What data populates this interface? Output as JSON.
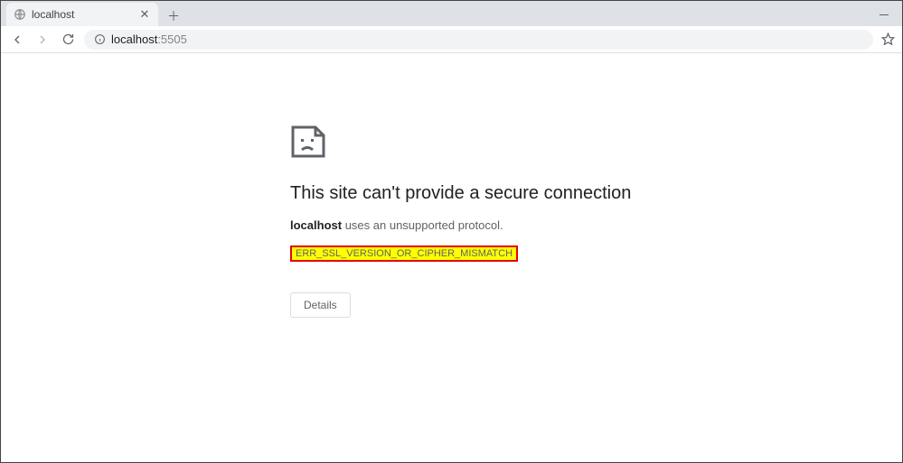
{
  "tab": {
    "title": "localhost"
  },
  "omnibox": {
    "url_host": "localhost",
    "url_port": ":5505"
  },
  "error": {
    "title": "This site can't provide a secure connection",
    "host": "localhost",
    "message_suffix": " uses an unsupported protocol.",
    "code": "ERR_SSL_VERSION_OR_CIPHER_MISMATCH",
    "details_label": "Details"
  }
}
